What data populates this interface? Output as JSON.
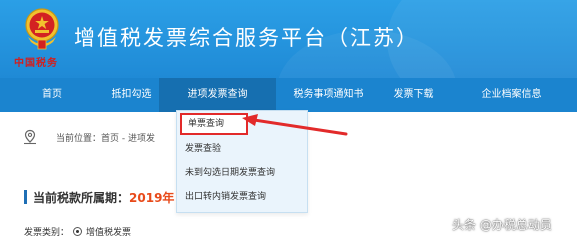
{
  "header": {
    "logo_text": "中国税务",
    "title": "增值税发票综合服务平台（江苏）"
  },
  "nav": {
    "items": [
      {
        "label": "首页"
      },
      {
        "label": "抵扣勾选"
      },
      {
        "label": "进项发票查询"
      },
      {
        "label": "税务事项通知书"
      },
      {
        "label": "发票下载"
      },
      {
        "label": "企业档案信息"
      }
    ]
  },
  "dropdown": {
    "items": [
      {
        "label": "单票查询"
      },
      {
        "label": "发票查验"
      },
      {
        "label": "未到勾选日期发票查询"
      },
      {
        "label": "出口转内销发票查询"
      }
    ]
  },
  "breadcrumb": {
    "prefix": "当前位置：",
    "path": "首页 - 进项发"
  },
  "tax_period": {
    "label": "当前税款所属期：",
    "value": "2019年"
  },
  "invoice_type": {
    "label": "发票类别：",
    "option": "增值税发票"
  },
  "watermark": "头条 @办税总动员",
  "colors": {
    "header_bg": "#2196e3",
    "nav_bg": "#1b84cf",
    "highlight_border": "#e22a2a",
    "period_value": "#e84a1a"
  }
}
